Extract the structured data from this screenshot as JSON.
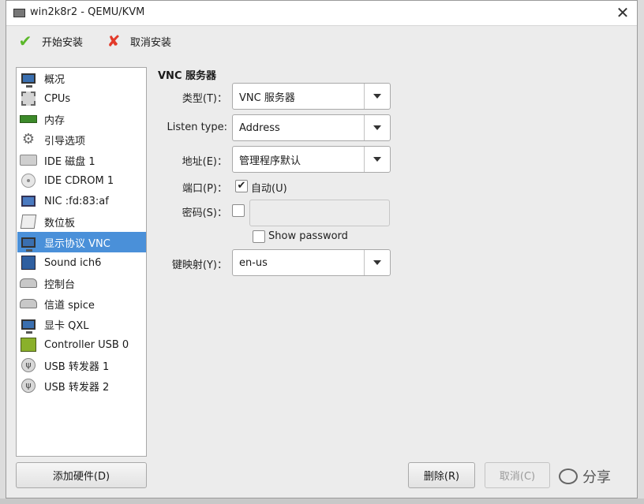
{
  "window": {
    "title": "win2k8r2 - QEMU/KVM"
  },
  "toolbar": {
    "start_install": "开始安装",
    "cancel_install": "取消安装"
  },
  "sidebar": {
    "items": [
      {
        "label": "概况",
        "icon": "monitor-icon"
      },
      {
        "label": "CPUs",
        "icon": "cpu-icon"
      },
      {
        "label": "内存",
        "icon": "memory-icon"
      },
      {
        "label": "引导选项",
        "icon": "boot-options-icon"
      },
      {
        "label": "IDE 磁盘 1",
        "icon": "disk-icon"
      },
      {
        "label": "IDE CDROM 1",
        "icon": "cdrom-icon"
      },
      {
        "label": "NIC :fd:83:af",
        "icon": "network-icon"
      },
      {
        "label": "数位板",
        "icon": "tablet-icon"
      },
      {
        "label": "显示协议  VNC",
        "icon": "display-icon",
        "selected": true
      },
      {
        "label": "Sound ich6",
        "icon": "sound-icon"
      },
      {
        "label": "控制台",
        "icon": "console-icon"
      },
      {
        "label": "信道  spice",
        "icon": "channel-icon"
      },
      {
        "label": "显卡  QXL",
        "icon": "video-card-icon"
      },
      {
        "label": "Controller USB 0",
        "icon": "usb-controller-icon"
      },
      {
        "label": "USB 转发器 1",
        "icon": "usb-icon"
      },
      {
        "label": "USB 转发器 2",
        "icon": "usb-icon"
      }
    ],
    "add_hardware": "添加硬件(D)"
  },
  "main": {
    "section_title": "VNC 服务器",
    "type_label": "类型(T)：",
    "type_value": "VNC 服务器",
    "listen_type_label": "Listen type:",
    "listen_type_value": "Address",
    "address_label": "地址(E)：",
    "address_value": "管理程序默认",
    "port_label": "端口(P)：",
    "port_auto_label": "自动(U)",
    "port_auto_checked": true,
    "password_label": "密码(S)：",
    "password_checked": false,
    "password_value": "",
    "show_password_label": "Show password",
    "keymap_label": "键映射(Y)：",
    "keymap_value": "en-us"
  },
  "footer": {
    "remove": "删除(R)",
    "cancel": "取消(C)"
  },
  "watermark": {
    "text": "分享"
  },
  "colors": {
    "selection": "#4a90d9",
    "check": "#5bb82a",
    "cross": "#e23a2a"
  }
}
